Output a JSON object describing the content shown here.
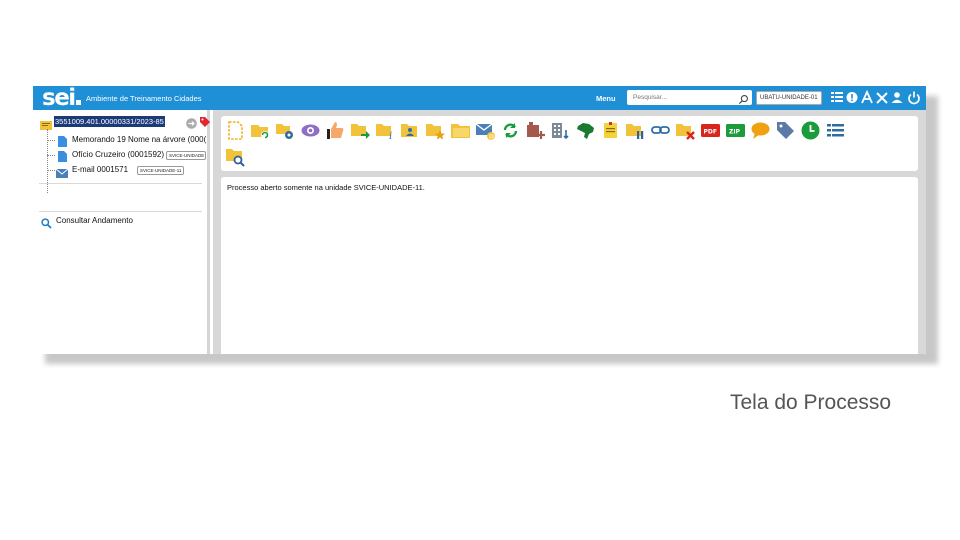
{
  "app": {
    "logo": "sei",
    "subtitle": "Ambiente de Treinamento Cidades",
    "menu_label": "Menu",
    "search_placeholder": "Pesquisar...",
    "unit_badge": "UBATU-UNIDADE-01",
    "brand_color": "#1f8fd6"
  },
  "tree": {
    "process_number": "3551009.401.00000331/2023-85",
    "items": [
      {
        "label": "Memorando 19 Nome na árvore (000(",
        "icon": "document-icon",
        "badge": ""
      },
      {
        "label": "Ofício Cruzeiro (0001592)",
        "icon": "document-icon",
        "badge": "SVICE-UNIDADE"
      },
      {
        "label": "E-mail 0001571",
        "icon": "email-icon",
        "badge": "SVICE-UNIDADE-11"
      }
    ],
    "consult_label": "Consultar Andamento"
  },
  "toolbar": {
    "icons": [
      "new-document-icon",
      "relate-process-icon",
      "process-settings-icon",
      "view-icon",
      "signal-icon",
      "send-process-icon",
      "info-icon",
      "assign-icon",
      "favorite-icon",
      "folder-icon",
      "email-icon",
      "refresh-icon",
      "add-block-icon",
      "organization-icon",
      "brazil-map-icon",
      "note-icon",
      "suspend-icon",
      "link-icon",
      "close-process-icon",
      "pdf-icon",
      "zip-icon",
      "comment-icon",
      "tag-icon",
      "clock-icon",
      "list-icon",
      "search-folder-icon"
    ],
    "pdf_text": "PDF",
    "zip_text": "ZIP"
  },
  "content": {
    "message_prefix": "Processo aberto somente na unidade ",
    "message_unit": "SVICE-UNIDADE-11",
    "message_suffix": "."
  },
  "caption": "Tela do Processo"
}
